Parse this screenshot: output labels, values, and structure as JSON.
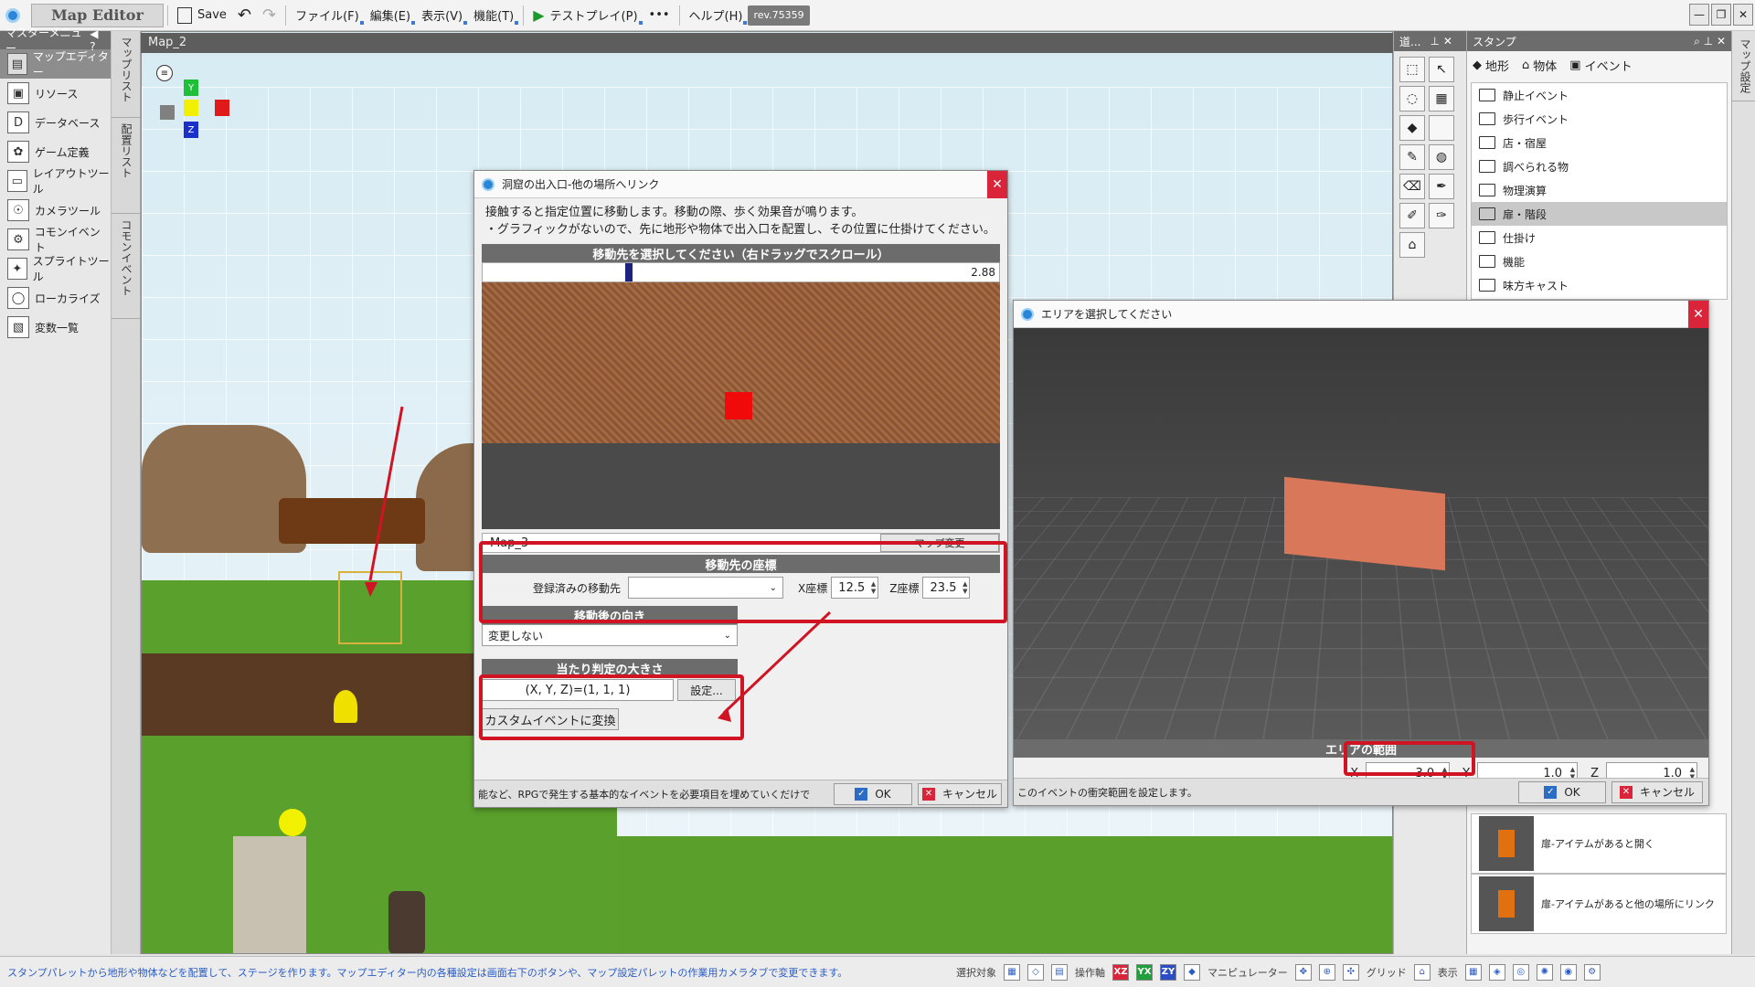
{
  "titlebar": {
    "app_title": "Map Editor",
    "save": "Save",
    "menu_file": "ファイル(F)",
    "menu_edit": "編集(E)",
    "menu_view": "表示(V)",
    "menu_function": "機能(T)",
    "test_play": "テストプレイ(P)",
    "more": "•••",
    "menu_help": "ヘルプ(H)",
    "revision": "rev.75359"
  },
  "leftnav": {
    "header": "マスターメニュー",
    "help": "?",
    "items": [
      {
        "label": "マップエディター",
        "icon": "map-editor-icon"
      },
      {
        "label": "リソース",
        "icon": "resource-icon"
      },
      {
        "label": "データベース",
        "icon": "database-icon"
      },
      {
        "label": "ゲーム定義",
        "icon": "game-definition-icon"
      },
      {
        "label": "レイアウトツール",
        "icon": "layout-tool-icon"
      },
      {
        "label": "カメラツール",
        "icon": "camera-tool-icon"
      },
      {
        "label": "コモンイベント",
        "icon": "common-event-icon"
      },
      {
        "label": "スプライトツール",
        "icon": "sprite-tool-icon"
      },
      {
        "label": "ローカライズ",
        "icon": "localize-icon"
      },
      {
        "label": "変数一覧",
        "icon": "variable-list-icon"
      }
    ]
  },
  "vtabs": [
    "マップリスト",
    "配置リスト",
    "コモンイベント"
  ],
  "viewport": {
    "tab": "Map_2",
    "gizmo": {
      "y": "Y",
      "z": "Z"
    }
  },
  "link_dialog": {
    "title": "洞窟の出入口-他の場所へリンク",
    "desc_line1": "接触すると指定位置に移動します。移動の際、歩く効果音が鳴ります。",
    "desc_line2": "・グラフィックがないので、先に地形や物体で出入口を配置し、その位置に仕掛けてください。",
    "select_header": "移動先を選択してください（右ドラッグでスクロール）",
    "zoom": "2.88",
    "map_name": "Map_3",
    "map_change": "マップ変更",
    "dest_header": "移動先の座標",
    "registered_label": "登録済みの移動先",
    "registered_value": "",
    "x_label": "X座標",
    "x_value": "12.5",
    "z_label": "Z座標",
    "z_value": "23.5",
    "direction_header": "移動後の向き",
    "direction_value": "変更しない",
    "hitbox_header": "当たり判定の大きさ",
    "hitbox_value": "(X, Y, Z)=(1, 1, 1)",
    "settings_button": "設定...",
    "custom_event": "カスタムイベントに変換",
    "footer_text": "能など、RPGで発生する基本的なイベントを必要項目を埋めていくだけで",
    "ok": "OK",
    "cancel": "キャンセル"
  },
  "area_dialog": {
    "title": "エリアを選択してください",
    "range_header": "エリアの範囲",
    "x_label": "X",
    "x_value": "3.0",
    "y_label": "Y",
    "y_value": "1.0",
    "z_label": "Z",
    "z_value": "1.0",
    "footer_text": "このイベントの衝突範囲を設定します。",
    "ok": "OK",
    "cancel": "キャンセル"
  },
  "tool_panel": {
    "header": "道..."
  },
  "stamp_panel": {
    "header": "スタンプ",
    "tabs": [
      "地形",
      "物体",
      "イベント"
    ],
    "categories": [
      "静止イベント",
      "歩行イベント",
      "店・宿屋",
      "調べられる物",
      "物理演算",
      "扉・階段",
      "仕掛け",
      "機能",
      "味方キャスト"
    ],
    "selected_index": 5,
    "items": [
      "扉-アイテムがあると開く",
      "扉-アイテムがあると他の場所にリンク"
    ]
  },
  "right_vtab": "マップ設定",
  "statusbar": {
    "message": "スタンプパレットから地形や物体などを配置して、ステージを作ります。マップエディター内の各種設定は画面右下のボタンや、マップ設定パレットの作業用カメラタブで変更できます。",
    "select_target": "選択対象",
    "collision_axis": "操作軸",
    "manipulator": "マニピュレーター",
    "grid": "グリッド",
    "display": "表示",
    "axis_xz": "XZ",
    "axis_yx": "YX",
    "axis_zy": "ZY"
  }
}
